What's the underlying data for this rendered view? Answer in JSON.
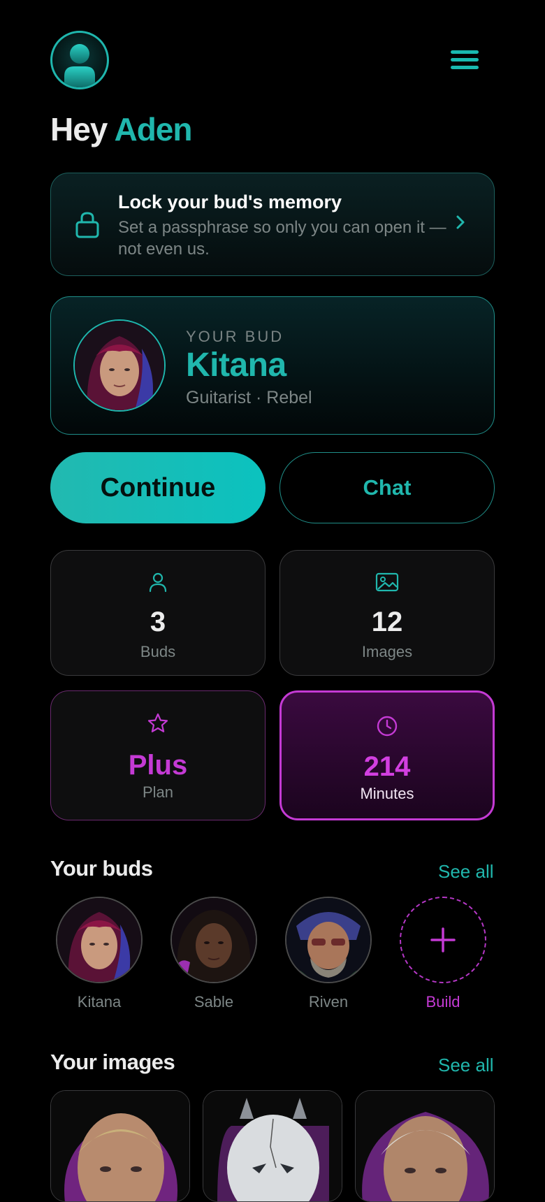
{
  "header": {
    "greeting_prefix": "Hey",
    "user_name": "Aden"
  },
  "lock_card": {
    "title": "Lock your bud's memory",
    "description": "Set a passphrase so only you can open it — not even us."
  },
  "current_bud": {
    "label": "YOUR BUD",
    "name": "Kitana",
    "traits": "Guitarist · Rebel"
  },
  "actions": {
    "continue_label": "Continue",
    "chat_label": "Chat"
  },
  "stats": {
    "buds": {
      "value": "3",
      "label": "Buds"
    },
    "images": {
      "value": "12",
      "label": "Images"
    },
    "plan": {
      "value": "Plus",
      "label": "Plan"
    },
    "minutes": {
      "value": "214",
      "label": "Minutes"
    }
  },
  "buds_section": {
    "title": "Your buds",
    "see_all": "See all",
    "items": [
      {
        "name": "Kitana"
      },
      {
        "name": "Sable"
      },
      {
        "name": "Riven"
      }
    ],
    "build_label": "Build"
  },
  "images_section": {
    "title": "Your images",
    "see_all": "See all"
  },
  "colors": {
    "accent_teal": "#20b7ad",
    "accent_magenta": "#c43ad4",
    "background": "#000000"
  }
}
